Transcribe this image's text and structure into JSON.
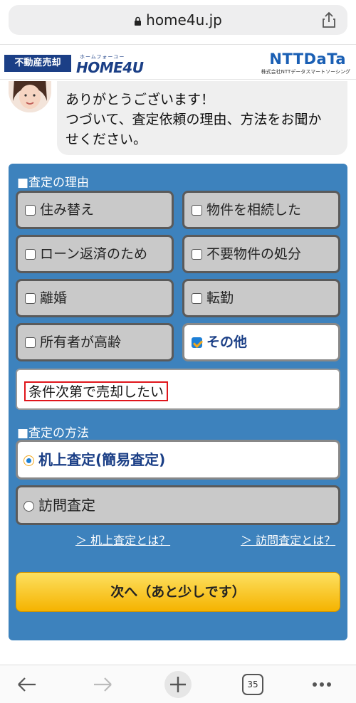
{
  "browser": {
    "url": "home4u.jp",
    "tab_count": "35"
  },
  "header": {
    "badge": "不動産売却",
    "logo_sub": "ホームフォーユー",
    "logo_main": "HOME4U",
    "partner_logo": "NTTDaTa",
    "partner_sub": "株式会社NTTデータスマートソーシング"
  },
  "chat": {
    "line1": "ありがとうございます！",
    "line2": "つづいて、査定依頼の理由、方法をお聞か",
    "line3": "せください。"
  },
  "reasons": {
    "title": "■査定の理由",
    "options": [
      {
        "label": "住み替え",
        "checked": false
      },
      {
        "label": "物件を相続した",
        "checked": false
      },
      {
        "label": "ローン返済のため",
        "checked": false
      },
      {
        "label": "不要物件の処分",
        "checked": false
      },
      {
        "label": "離婚",
        "checked": false
      },
      {
        "label": "転勤",
        "checked": false
      },
      {
        "label": "所有者が高齢",
        "checked": false
      },
      {
        "label": "その他",
        "checked": true
      }
    ],
    "other_value": "条件次第で売却したい"
  },
  "methods": {
    "title": "■査定の方法",
    "options": [
      {
        "label": "机上査定(簡易査定)",
        "selected": true
      },
      {
        "label": "訪問査定",
        "selected": false
      }
    ],
    "link_desk": "＞ 机上査定とは？",
    "link_visit": "＞ 訪問査定とは？"
  },
  "next_button": "次へ（あと少しです）",
  "colors": {
    "panel": "#3d82bd",
    "brand": "#1b3f86",
    "button": "#f5b300",
    "highlight": "#e0151b"
  }
}
